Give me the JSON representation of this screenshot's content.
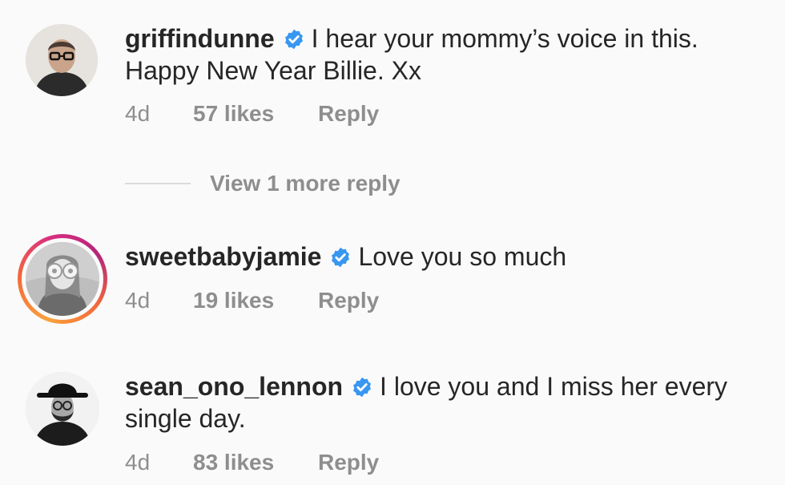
{
  "comments": [
    {
      "username": "griffindunne",
      "text": "I hear your mommy’s voice in this.",
      "text_line2": "Happy New Year Billie. Xx",
      "age": "4d",
      "likes": "57 likes",
      "reply": "Reply",
      "verified": true
    },
    {
      "username": "sweetbabyjamie",
      "text": "Love you so much",
      "age": "4d",
      "likes": "19 likes",
      "reply": "Reply",
      "verified": true
    },
    {
      "username": "sean_ono_lennon",
      "text": "I love you and I miss her every",
      "text_line2": "single day.",
      "age": "4d",
      "likes": "83 likes",
      "reply": "Reply",
      "verified": true
    }
  ],
  "view_more_replies": "View 1 more reply",
  "colors": {
    "verified_blue": "#3897f0",
    "meta_gray": "#8e8e8e",
    "text_dark": "#262626"
  }
}
